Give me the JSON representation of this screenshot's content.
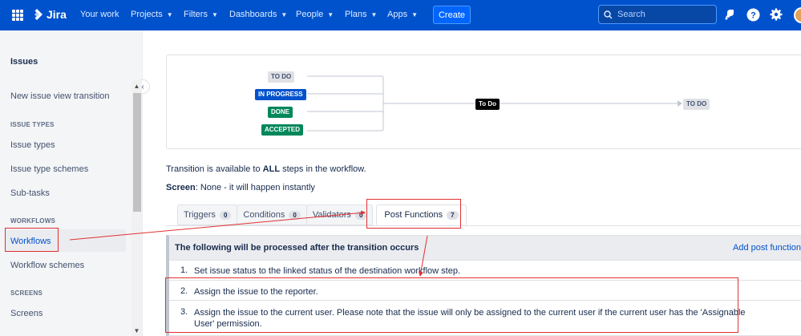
{
  "nav": {
    "logo_text": "Jira",
    "items": [
      {
        "label": "Your work",
        "has_chevron": false
      },
      {
        "label": "Projects",
        "has_chevron": true
      },
      {
        "label": "Filters",
        "has_chevron": true
      },
      {
        "label": "Dashboards",
        "has_chevron": true
      },
      {
        "label": "People",
        "has_chevron": true
      },
      {
        "label": "Plans",
        "has_chevron": true
      },
      {
        "label": "Apps",
        "has_chevron": true
      }
    ],
    "create_label": "Create",
    "search_placeholder": "Search",
    "icons": [
      "app-switcher-icon",
      "jira-logo-icon",
      "search-icon",
      "notifications-icon",
      "help-icon",
      "settings-icon",
      "avatar"
    ],
    "colors": {
      "bar": "#0052CC",
      "create": "#0065FF"
    }
  },
  "sidebar": {
    "title": "Issues",
    "items": [
      {
        "label": "New issue view transition",
        "type": "link"
      },
      {
        "label": "ISSUE TYPES",
        "type": "heading"
      },
      {
        "label": "Issue types",
        "type": "link"
      },
      {
        "label": "Issue type schemes",
        "type": "link"
      },
      {
        "label": "Sub-tasks",
        "type": "link"
      },
      {
        "label": "WORKFLOWS",
        "type": "heading"
      },
      {
        "label": "Workflows",
        "type": "link",
        "active": true
      },
      {
        "label": "Workflow schemes",
        "type": "link"
      },
      {
        "label": "SCREENS",
        "type": "heading"
      },
      {
        "label": "Screens",
        "type": "link"
      }
    ]
  },
  "diagram": {
    "from_statuses": [
      {
        "label": "TO DO",
        "category": "todo"
      },
      {
        "label": "IN PROGRESS",
        "category": "in-progress"
      },
      {
        "label": "DONE",
        "category": "done"
      },
      {
        "label": "ACCEPTED",
        "category": "done"
      }
    ],
    "transition_label": "To Do",
    "to_status": "TO DO"
  },
  "info": {
    "availability_prefix": "Transition is available to ",
    "availability_bold": "ALL",
    "availability_suffix": " steps in the workflow.",
    "screen_label": "Screen",
    "screen_value": ": None - it will happen instantly"
  },
  "tabs": [
    {
      "label": "Triggers",
      "count": "0",
      "active": false
    },
    {
      "label": "Conditions",
      "count": "0",
      "active": false
    },
    {
      "label": "Validators",
      "count": "0",
      "active": false
    },
    {
      "label": "Post Functions",
      "count": "7",
      "active": true
    }
  ],
  "post_functions": {
    "header": "The following will be processed after the transition occurs",
    "add_link": "Add post function",
    "rows": [
      {
        "num": "1.",
        "text": "Set issue status to the linked status of the destination workflow step."
      },
      {
        "num": "2.",
        "text": "Assign the issue to the reporter."
      },
      {
        "num": "3.",
        "text": "Assign the issue to the current user. Please note that the issue will only be assigned to the current user if the current user has the 'Assignable User' permission."
      }
    ]
  }
}
